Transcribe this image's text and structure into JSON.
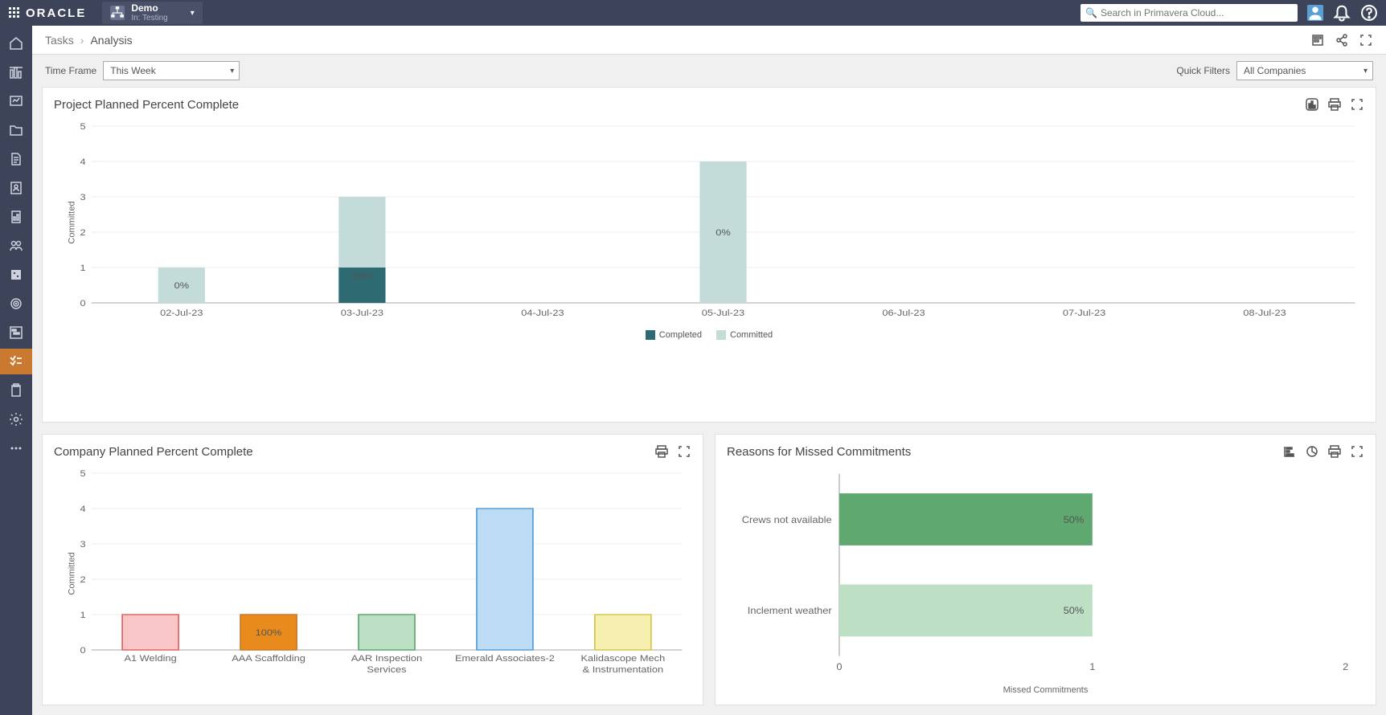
{
  "header": {
    "brand": "ORACLE",
    "context_title": "Demo",
    "context_subtitle": "In: Testing",
    "search_placeholder": "Search in Primavera Cloud..."
  },
  "breadcrumb": {
    "parent": "Tasks",
    "current": "Analysis"
  },
  "filters": {
    "time_frame_label": "Time Frame",
    "time_frame_value": "This Week",
    "quick_filters_label": "Quick Filters",
    "quick_filters_value": "All Companies"
  },
  "panels": {
    "project_planned": {
      "title": "Project Planned Percent Complete",
      "ylabel": "Committed",
      "legend": {
        "completed": "Completed",
        "committed": "Committed"
      }
    },
    "company_planned": {
      "title": "Company Planned Percent Complete",
      "ylabel": "Committed"
    },
    "reasons": {
      "title": "Reasons for Missed Commitments",
      "xlabel": "Missed Commitments"
    }
  },
  "colors": {
    "completed": "#2d6a72",
    "committed": "#c3dcd9",
    "company": [
      "#f8c6c6",
      "#e88b1c",
      "#bde0c4",
      "#bcdcf5",
      "#f6efb0"
    ],
    "company_stroke": [
      "#e06666",
      "#c97a2f",
      "#5fa870",
      "#5a9fd4",
      "#d4c850"
    ],
    "reason_dark": "#5fa870",
    "reason_light": "#bde0c4"
  },
  "chart_data": [
    {
      "id": "project_planned",
      "type": "bar",
      "stacked": true,
      "ylabel": "Committed",
      "ylim": [
        0,
        5
      ],
      "yticks": [
        0,
        1,
        2,
        3,
        4,
        5
      ],
      "categories": [
        "02-Jul-23",
        "03-Jul-23",
        "04-Jul-23",
        "05-Jul-23",
        "06-Jul-23",
        "07-Jul-23",
        "08-Jul-23"
      ],
      "series": [
        {
          "name": "Completed",
          "values": [
            0,
            1,
            0,
            0,
            0,
            0,
            0
          ]
        },
        {
          "name": "Committed",
          "values": [
            1,
            2,
            0,
            4,
            0,
            0,
            0
          ]
        }
      ],
      "bar_labels": [
        "0%",
        "33%",
        "",
        "0%",
        "",
        "",
        ""
      ]
    },
    {
      "id": "company_planned",
      "type": "bar",
      "ylabel": "Committed",
      "ylim": [
        0,
        5
      ],
      "yticks": [
        0,
        1,
        2,
        3,
        4,
        5
      ],
      "categories": [
        "A1 Welding",
        "AAA Scaffolding",
        "AAR Inspection Services",
        "Emerald Associates-2",
        "Kalidascope Mech & Instrumentation"
      ],
      "values": [
        1,
        1,
        1,
        4,
        1
      ],
      "bar_labels": [
        "",
        "100%",
        "",
        "",
        ""
      ]
    },
    {
      "id": "reasons",
      "type": "bar",
      "orientation": "horizontal",
      "xlabel": "Missed Commitments",
      "xlim": [
        0,
        2
      ],
      "xticks": [
        0,
        1,
        2
      ],
      "categories": [
        "Crews not available",
        "Inclement weather"
      ],
      "values": [
        1,
        1
      ],
      "bar_labels": [
        "50%",
        "50%"
      ]
    }
  ]
}
